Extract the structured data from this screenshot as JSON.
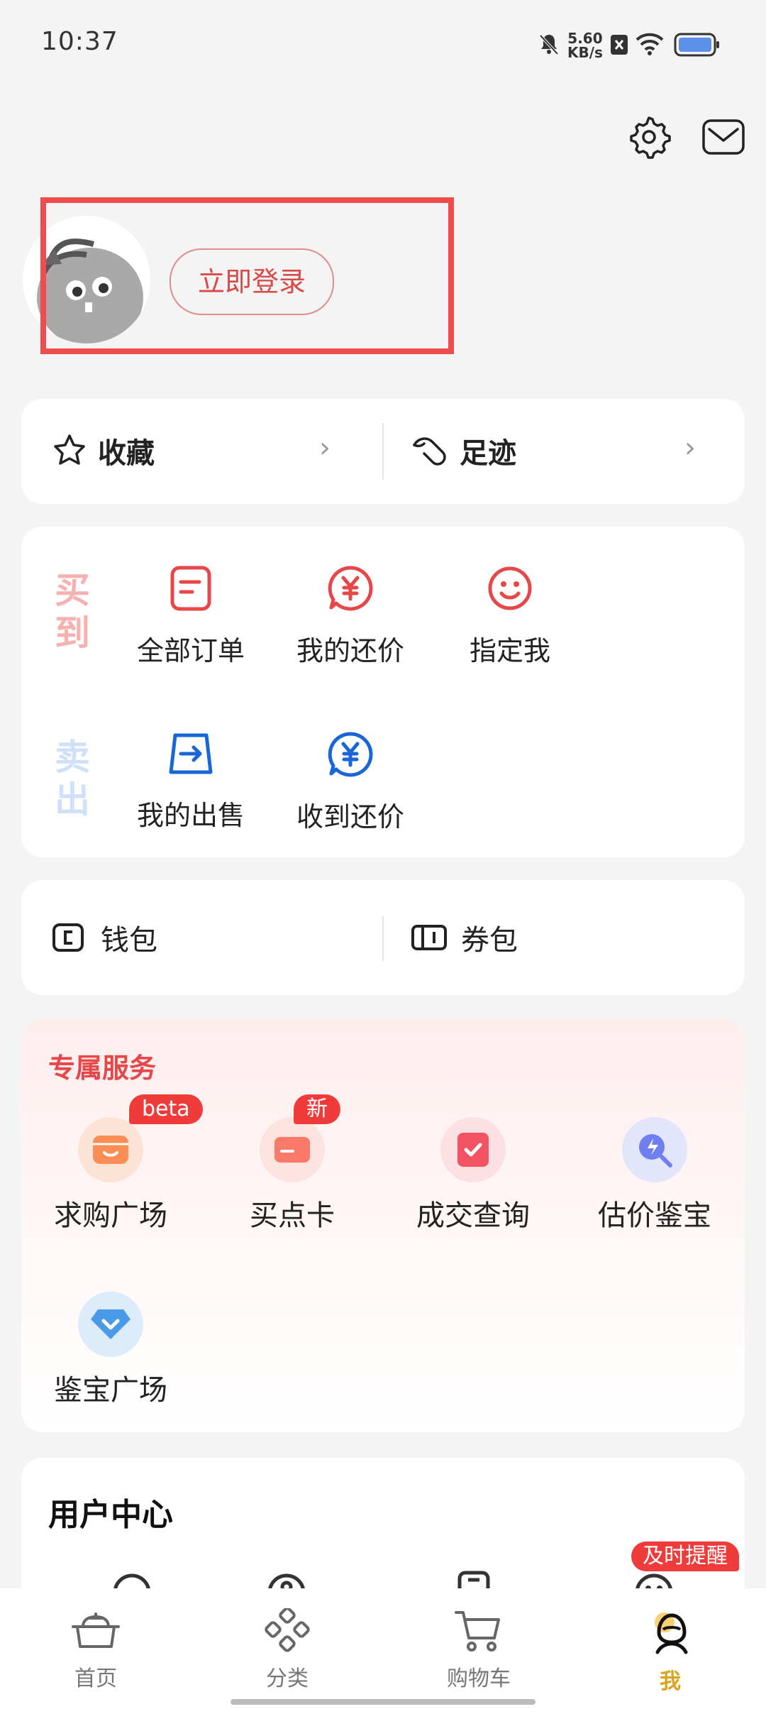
{
  "status_bar": {
    "time": "10:37",
    "speed_value": "5.60",
    "speed_unit": "KB/s"
  },
  "profile": {
    "login_label": "立即登录"
  },
  "quick_links": {
    "favorites_label": "收藏",
    "footprint_label": "足迹"
  },
  "orders": {
    "buy_side_label": "买到",
    "sell_side_label": "卖出",
    "buy_items": [
      {
        "label": "全部订单",
        "icon": "order-list-icon"
      },
      {
        "label": "我的还价",
        "icon": "yuan-bubble-icon"
      },
      {
        "label": "指定我",
        "icon": "smile-icon"
      }
    ],
    "sell_items": [
      {
        "label": "我的出售",
        "icon": "sell-arrow-icon"
      },
      {
        "label": "收到还价",
        "icon": "yuan-bubble-icon"
      }
    ]
  },
  "wallet": {
    "wallet_label": "钱包",
    "coupon_label": "券包"
  },
  "services": {
    "title": "专属服务",
    "items": [
      {
        "label": "求购广场",
        "badge": "beta",
        "icon": "store-icon"
      },
      {
        "label": "买点卡",
        "badge": "新",
        "icon": "card-icon"
      },
      {
        "label": "成交查询",
        "badge": "",
        "icon": "check-doc-icon"
      },
      {
        "label": "估价鉴宝",
        "badge": "",
        "icon": "appraise-search-icon"
      },
      {
        "label": "鉴宝广场",
        "badge": "",
        "icon": "diamond-icon"
      }
    ]
  },
  "user_center": {
    "title": "用户中心",
    "reminder_badge": "及时提醒"
  },
  "bottom_nav": {
    "items": [
      {
        "label": "首页",
        "icon": "home-pot-icon"
      },
      {
        "label": "分类",
        "icon": "category-icon"
      },
      {
        "label": "购物车",
        "icon": "cart-icon"
      },
      {
        "label": "我",
        "icon": "me-icon"
      }
    ],
    "active_color": "#d9a520"
  },
  "colors": {
    "accent_red": "#e8474a",
    "accent_blue": "#1a66d9",
    "label_pink": "#f6b1b1",
    "label_blue": "#cfe0f8"
  }
}
